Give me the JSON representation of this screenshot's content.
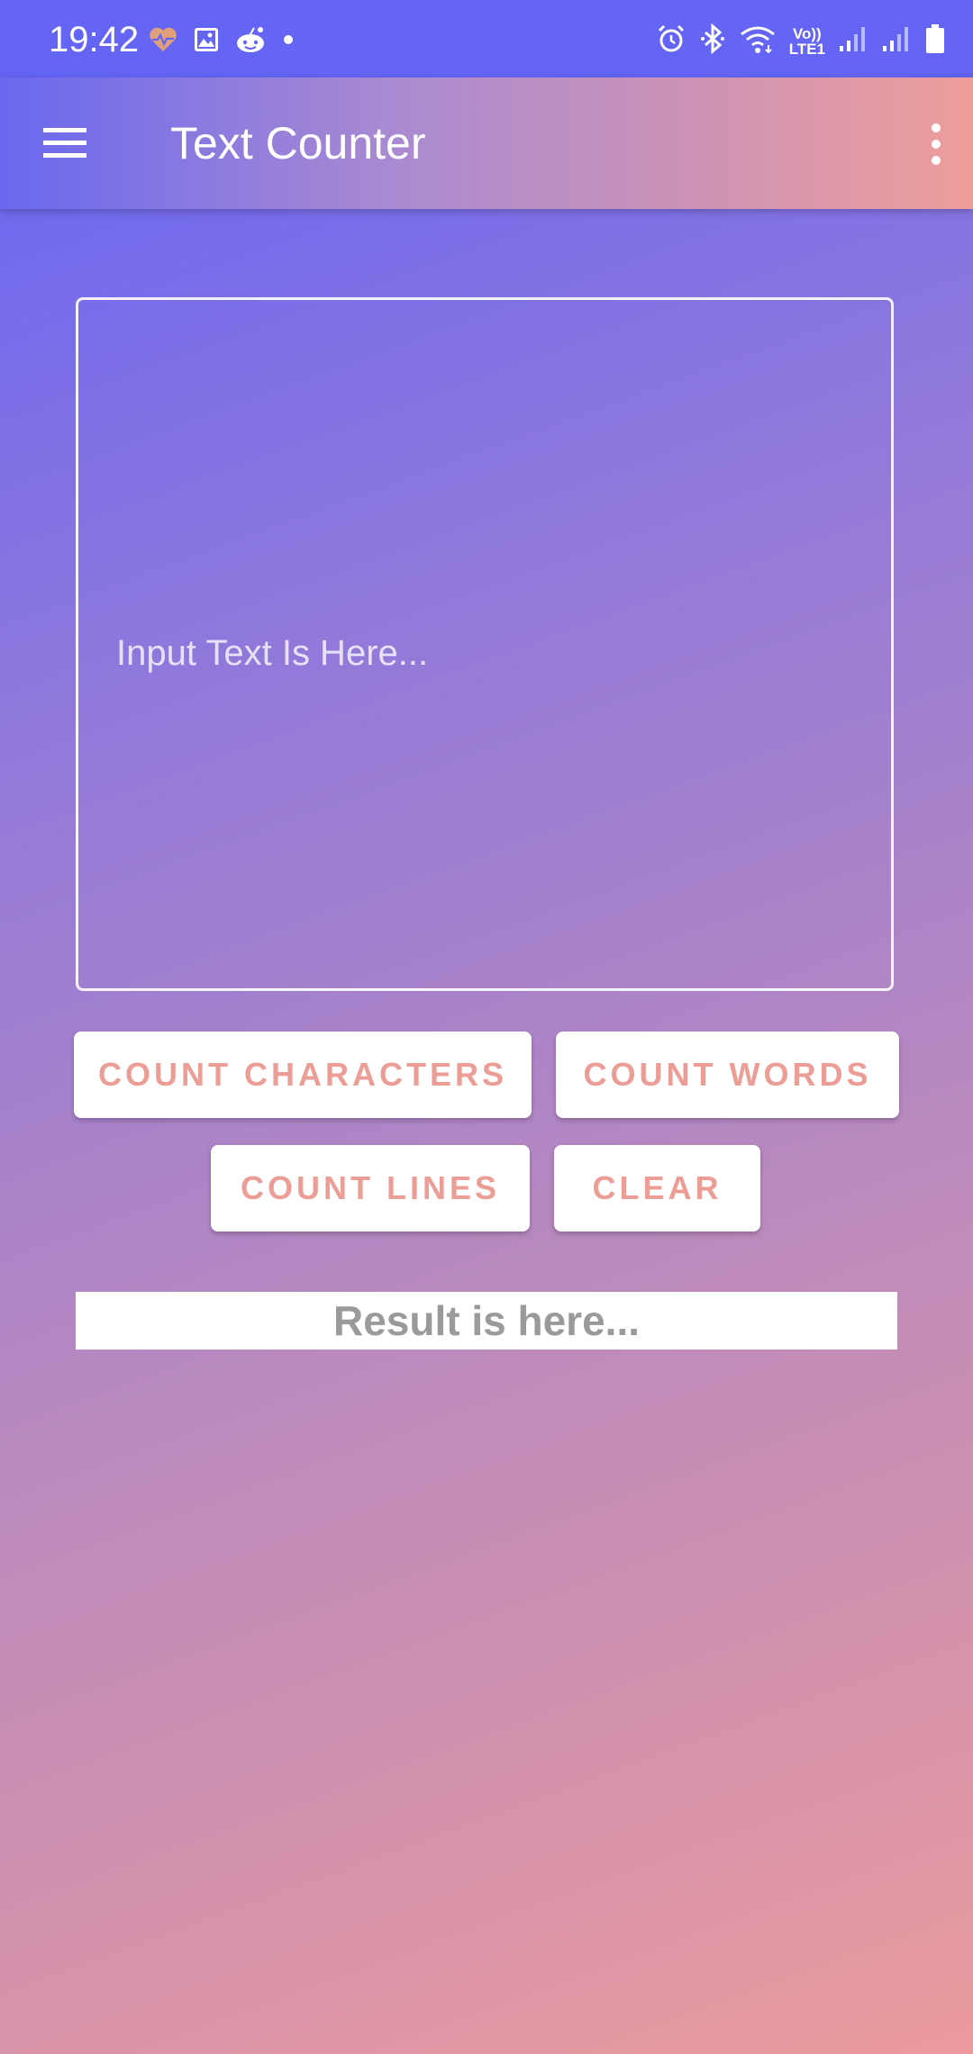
{
  "status_bar": {
    "time": "19:42",
    "network_label_top": "Vo))",
    "network_label_bottom": "LTE1",
    "left_icons": [
      "heart-monitor-icon",
      "gallery-icon",
      "reddit-icon",
      "dot-icon"
    ],
    "right_icons": [
      "alarm-icon",
      "bluetooth-icon",
      "wifi-icon",
      "signal-icon",
      "battery-icon"
    ]
  },
  "app_bar": {
    "title": "Text Counter",
    "menu_icon": "hamburger-menu-icon",
    "overflow_icon": "more-vert-icon"
  },
  "input": {
    "value": "",
    "placeholder": "Input Text Is Here..."
  },
  "buttons": {
    "count_characters": "COUNT CHARACTERS",
    "count_words": "COUNT WORDS",
    "count_lines": "COUNT LINES",
    "clear": "CLEAR"
  },
  "result": {
    "text": "Result is here..."
  },
  "colors": {
    "status_bar": "#6464f5",
    "button_text": "#ec9d96",
    "result_text": "#9a9a9a",
    "gradient_start": "#6464f5",
    "gradient_end": "#eb9a9c"
  }
}
